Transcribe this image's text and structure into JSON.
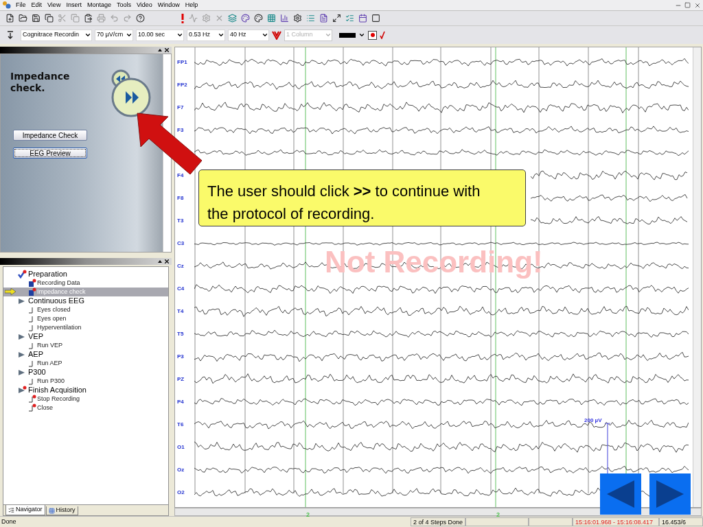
{
  "menu": [
    "File",
    "Edit",
    "View",
    "Insert",
    "Montage",
    "Tools",
    "Video",
    "Window",
    "Help"
  ],
  "combos": [
    {
      "value": "Cognitrace Recordin",
      "disabled": false
    },
    {
      "value": "70 µV/cm",
      "disabled": false
    },
    {
      "value": "10.00 sec",
      "disabled": false
    },
    {
      "value": "0.53 Hz",
      "disabled": false
    },
    {
      "value": "40 Hz",
      "disabled": false
    },
    {
      "value": "1 Column",
      "disabled": true
    }
  ],
  "protocol_panel": {
    "title": "Impedance check.",
    "buttons": [
      {
        "label": "Impedance Check",
        "focused": false
      },
      {
        "label": "EEG Preview",
        "focused": true
      }
    ]
  },
  "tree": [
    {
      "label": "Preparation",
      "kind": "done",
      "flagged": true,
      "selected": false,
      "children": [
        {
          "label": "Recording Data",
          "kind": "task",
          "flagged": true,
          "selected": false
        },
        {
          "label": "Impedance check",
          "kind": "task",
          "flagged": true,
          "selected": true
        }
      ]
    },
    {
      "label": "Continuous EEG",
      "kind": "group",
      "flagged": false,
      "selected": false,
      "children": [
        {
          "label": "Eyes closed",
          "kind": "step",
          "flagged": false,
          "selected": false
        },
        {
          "label": "Eyes open",
          "kind": "step",
          "flagged": false,
          "selected": false
        },
        {
          "label": "Hyperventilation",
          "kind": "step",
          "flagged": false,
          "selected": false
        }
      ]
    },
    {
      "label": "VEP",
      "kind": "group",
      "flagged": false,
      "selected": false,
      "children": [
        {
          "label": "Run VEP",
          "kind": "step",
          "flagged": false,
          "selected": false
        }
      ]
    },
    {
      "label": "AEP",
      "kind": "group",
      "flagged": false,
      "selected": false,
      "children": [
        {
          "label": "Run AEP",
          "kind": "step",
          "flagged": false,
          "selected": false
        }
      ]
    },
    {
      "label": "P300",
      "kind": "group",
      "flagged": false,
      "selected": false,
      "children": [
        {
          "label": "Run P300",
          "kind": "step",
          "flagged": false,
          "selected": false
        }
      ]
    },
    {
      "label": "Finish Acquisition",
      "kind": "group",
      "flagged": true,
      "selected": false,
      "children": [
        {
          "label": "Stop Recording",
          "kind": "step",
          "flagged": true,
          "selected": false
        },
        {
          "label": "Close",
          "kind": "step",
          "flagged": true,
          "selected": false
        }
      ]
    }
  ],
  "tabs": [
    {
      "label": "Navigator",
      "selected": true
    },
    {
      "label": "History",
      "selected": false
    }
  ],
  "channels": [
    "FP1",
    "FP2",
    "F7",
    "F3",
    "F4",
    "F8",
    "T3",
    "C3",
    "Cz",
    "C4",
    "T4",
    "T5",
    "P3",
    "PZ",
    "P4",
    "T6",
    "O1",
    "Oz",
    "O2"
  ],
  "markers": [
    "2",
    "2"
  ],
  "scale_label": "200 µV",
  "overlay_text": "Not Recording!",
  "callout": "The user should click **>>** to continue with the protocol of recording.",
  "status_bar": {
    "message": "Done",
    "steps": "2 of 4 Steps Done",
    "time_range": "15:16:01.968 - 15:16:08.417",
    "position": "16.453/6"
  }
}
